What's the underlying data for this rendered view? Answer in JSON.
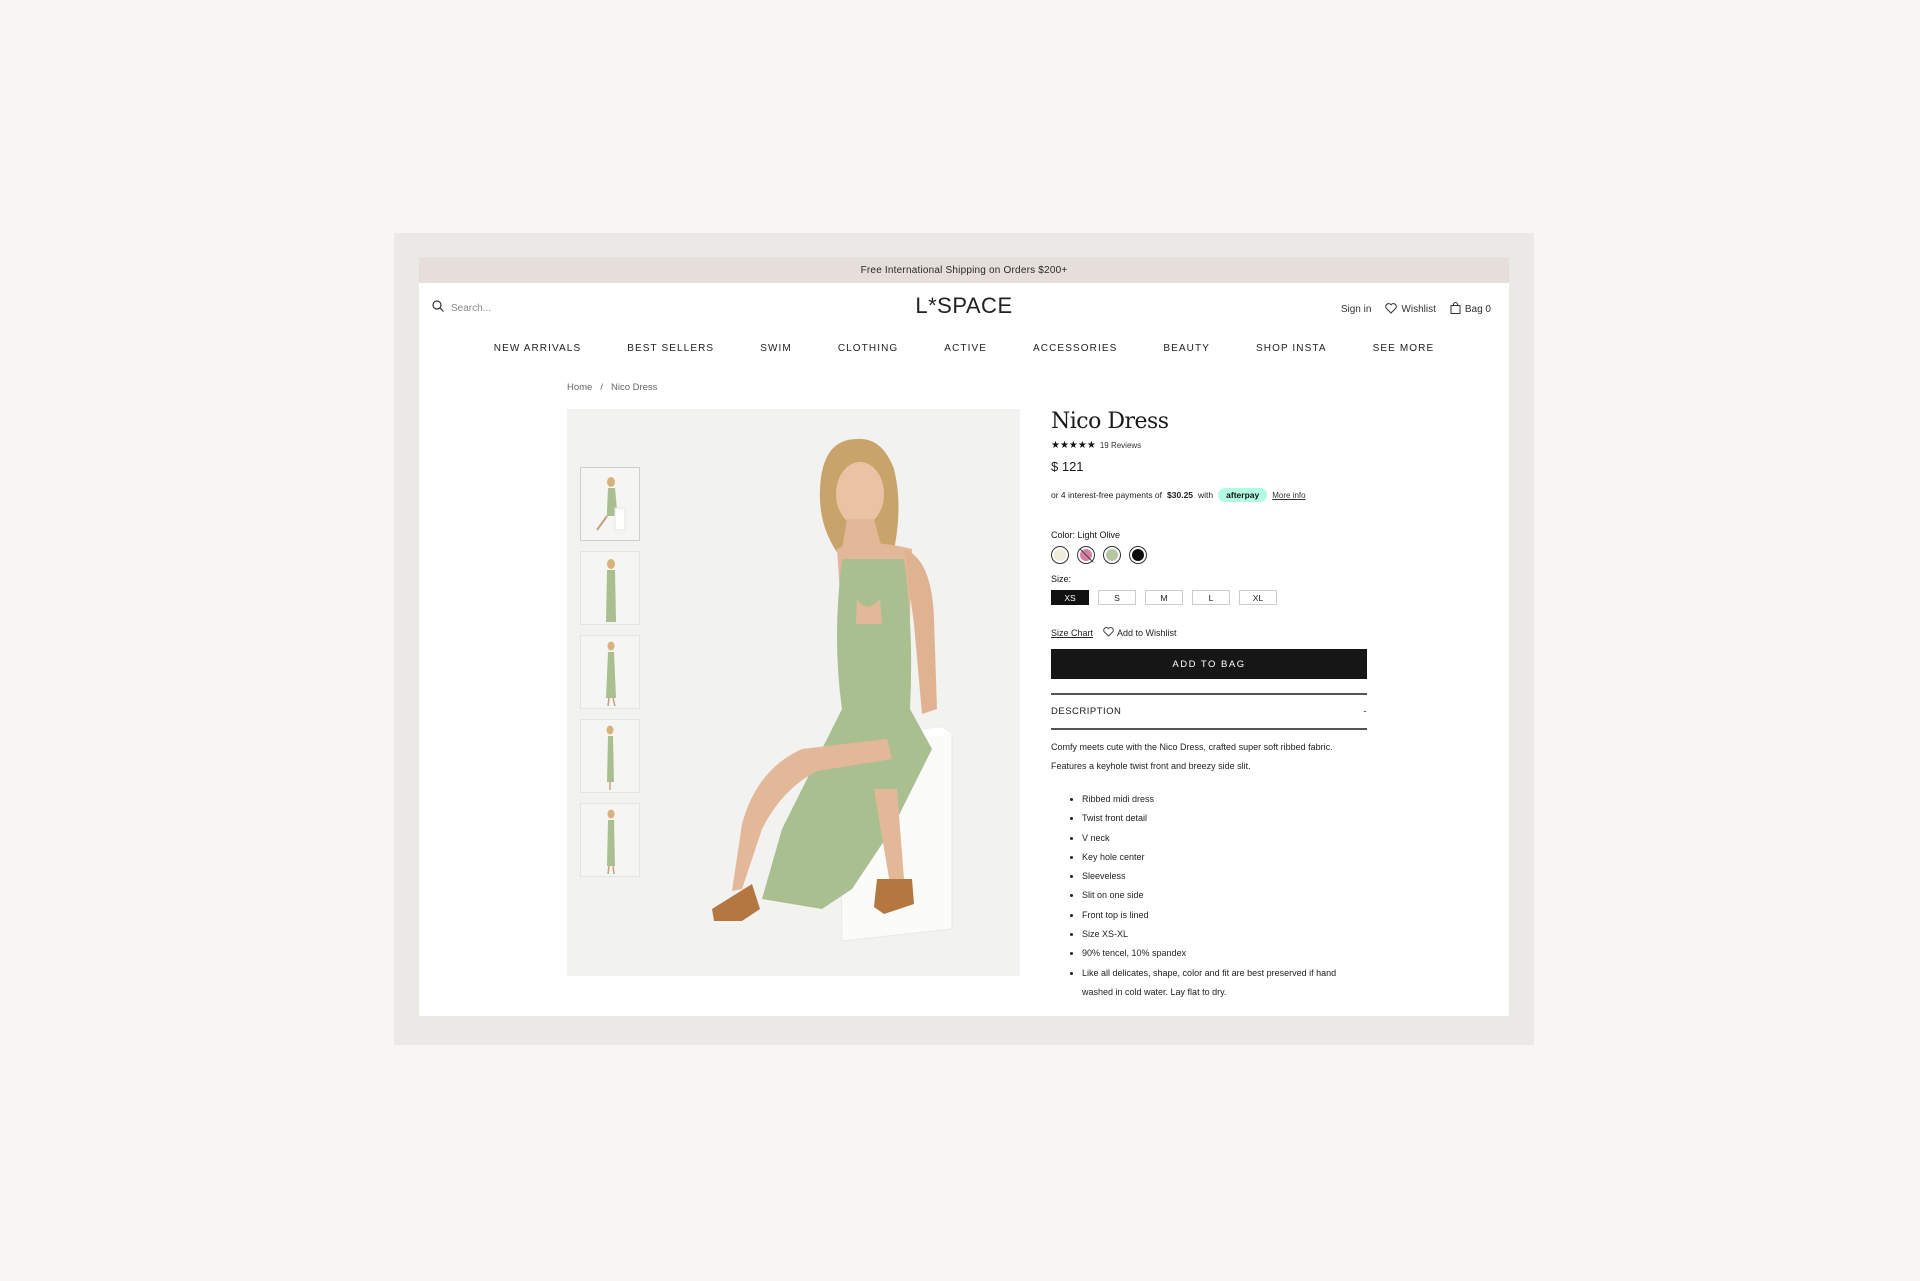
{
  "announcement": "Free International Shipping on Orders $200+",
  "header": {
    "search_placeholder": "Search...",
    "logo": "L*SPACE",
    "sign_in": "Sign in",
    "wishlist": "Wishlist",
    "bag": "Bag 0"
  },
  "nav": [
    "NEW ARRIVALS",
    "BEST SELLERS",
    "SWIM",
    "CLOTHING",
    "ACTIVE",
    "ACCESSORIES",
    "BEAUTY",
    "SHOP INSTA",
    "SEE MORE"
  ],
  "breadcrumb": {
    "home": "Home",
    "separator": "/",
    "current": "Nico Dress"
  },
  "product": {
    "title": "Nico Dress",
    "stars": "★★★★★",
    "reviews": "19 Reviews",
    "rating": 4.5,
    "price": "$ 121",
    "afterpay": {
      "prefix": "or 4 interest-free payments of",
      "amount": "$30.25",
      "with": "with",
      "badge": "afterpay",
      "more_info": "More info"
    },
    "color_label": "Color:",
    "color_value": "Light Olive",
    "swatches": [
      {
        "name": "cream",
        "color": "#efedda"
      },
      {
        "name": "pink",
        "color": "#d77fa4"
      },
      {
        "name": "light-olive",
        "color": "#b5c6a1"
      },
      {
        "name": "black",
        "color": "#0c0c0c"
      }
    ],
    "size_label": "Size:",
    "sizes": [
      "XS",
      "S",
      "M",
      "L",
      "XL"
    ],
    "selected_size": "XS",
    "size_chart": "Size Chart",
    "add_to_wishlist": "Add to Wishlist",
    "add_to_bag": "ADD TO BAG",
    "description_header": "DESCRIPTION",
    "description_toggle": "-",
    "description": "Comfy meets cute with the Nico Dress, crafted super soft ribbed fabric. Features a keyhole twist front and breezy side slit.",
    "bullets": [
      "Ribbed midi dress",
      "Twist front detail",
      "V neck",
      "Key hole center",
      "Sleeveless",
      "Slit on one side",
      "Front top is lined",
      "Size XS-XL",
      "90% tencel, 10% spandex",
      "Like all delicates, shape, color and fit are best preserved if hand washed in cold water. Lay flat to dry."
    ]
  },
  "colors": {
    "dress": "#a9bf90",
    "announcement_bg": "#e5dedb",
    "button_bg": "#161616",
    "afterpay_badge": "#b2fce4"
  }
}
